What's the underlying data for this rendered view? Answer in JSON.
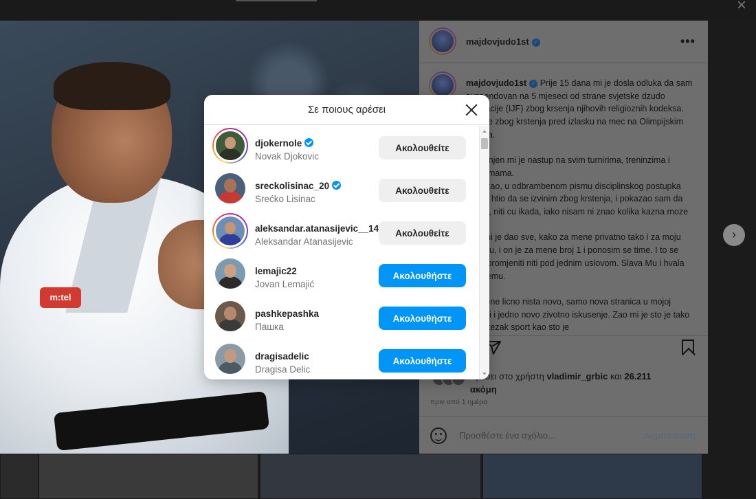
{
  "dialog": {
    "title": "Σε ποιους αρέσει",
    "close_icon": "close-icon",
    "likers": [
      {
        "username": "djokernole",
        "full_name": "Novak Djokovic",
        "verified": true,
        "story_ring": true,
        "button": "Ακολουθείτε",
        "button_style": "following"
      },
      {
        "username": "sreckolisinac_20",
        "full_name": "Srećko Lisinac",
        "verified": true,
        "story_ring": false,
        "button": "Ακολουθείτε",
        "button_style": "following"
      },
      {
        "username": "aleksandar.atanasijevic__14",
        "full_name": "Aleksandar Atanasijevic",
        "verified": false,
        "story_ring": true,
        "button": "Ακολουθείτε",
        "button_style": "following"
      },
      {
        "username": "lemajic22",
        "full_name": "Jovan Lemajić",
        "verified": false,
        "story_ring": false,
        "button": "Ακολουθήστε",
        "button_style": "follow"
      },
      {
        "username": "pashkepashka",
        "full_name": "Пашка",
        "verified": false,
        "story_ring": false,
        "button": "Ακολουθήστε",
        "button_style": "follow"
      },
      {
        "username": "dragisadelic",
        "full_name": "Dragisa Delic",
        "verified": false,
        "story_ring": false,
        "button": "Ακολουθήστε",
        "button_style": "follow"
      }
    ]
  },
  "post": {
    "author": "majdovjudo1st",
    "more_icon": "•••",
    "caption_text": "Prije 15 dana mi je dosla odluka da sam suspendovan na 5 mjeseci od strane svjetske dzudo federacije (IJF) zbog krsenja njihovih religioznih kodeksa. Tacnije zbog krstenja pred izlasku na mec na Olimpijskim Igrama.\n\nZabranjen mi je nastup na svim turnirima, treninzima i pripremama.\nDokazao, u odbrambenom pismu disciplinskog postupka nisam htio da se izvinim zbog krstenja, i pokazao sam da nisam, niti cu ikada, iako nisam ni znao kolika kazna moze biti.\nBog mi je dao sve, kako za mene privatno tako i za moju karijeru, i on je za mene broj 1 i ponosim se time. I to se nece promjeniti niti pod jednim uslovom. Slava Mu i hvala na svemu.\n\nZa mene licno nista novo, samo nova stranica u mojoj karijeri i jedno novo zivotno iskusenje. Zao mi je sto je tako lijep i tezak sport kao sto je",
    "likes_prefix": "Αρέσει στο χρήστη",
    "likes_user": "vladimir_grbic",
    "likes_and": "και",
    "likes_count": "26.211",
    "likes_suffix": "ακόμη",
    "time_ago": "πριν από 1 ημέρα",
    "comment_placeholder": "Προσθέστε ένα σχόλιο...",
    "post_button": "Δημοσίευση",
    "gi_logo": "m:tel"
  },
  "colors": {
    "follow_blue": "#0095f6",
    "following_gray": "#efefef",
    "verified_blue": "#0095f6"
  }
}
